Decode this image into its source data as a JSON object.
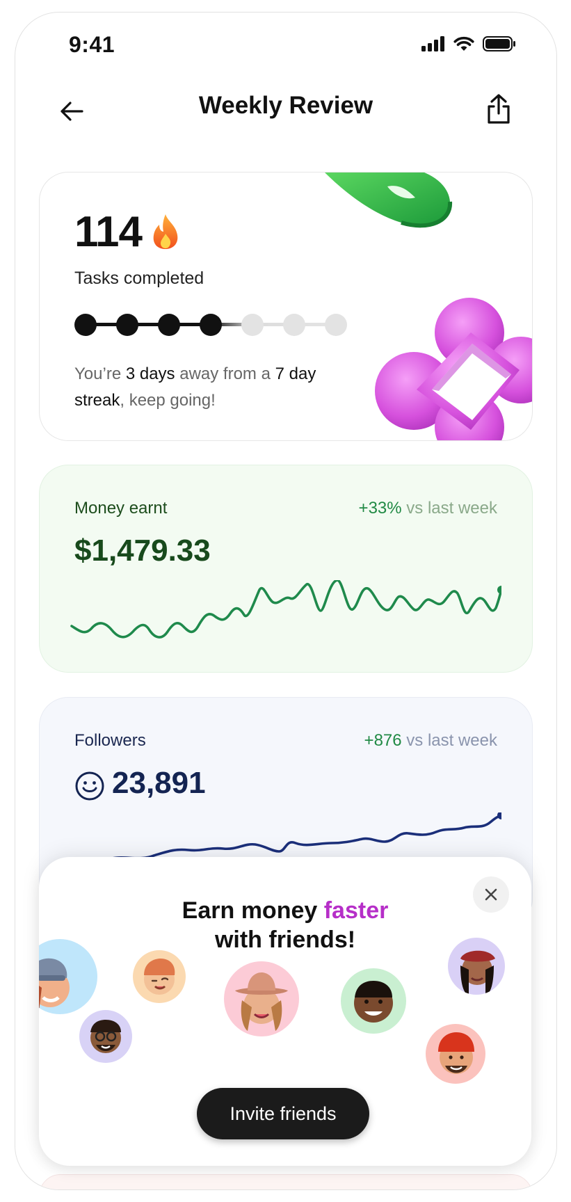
{
  "status_bar": {
    "time": "9:41"
  },
  "header": {
    "title": "Weekly Review"
  },
  "tasks": {
    "count": "114",
    "label": "Tasks completed",
    "streak_days_done": 4,
    "streak_days_total": 7,
    "message_part1": "You’re ",
    "message_bold1": "3 days",
    "message_part2": " away from a ",
    "message_bold2": "7 day streak",
    "message_part3": ", keep going!"
  },
  "money": {
    "label": "Money earnt",
    "change": "+33%",
    "change_suffix": " vs last week",
    "amount": "$1,479.33",
    "line_color": "#1f8a4c"
  },
  "followers": {
    "label": "Followers",
    "change": "+876",
    "change_suffix": " vs last week",
    "amount": "23,891",
    "line_color": "#1b2f7a"
  },
  "invite": {
    "title_part1": "Earn money ",
    "title_accent": "faster",
    "title_part2": "with friends!",
    "button_label": "Invite friends",
    "accent_color": "#b62fc8"
  }
}
